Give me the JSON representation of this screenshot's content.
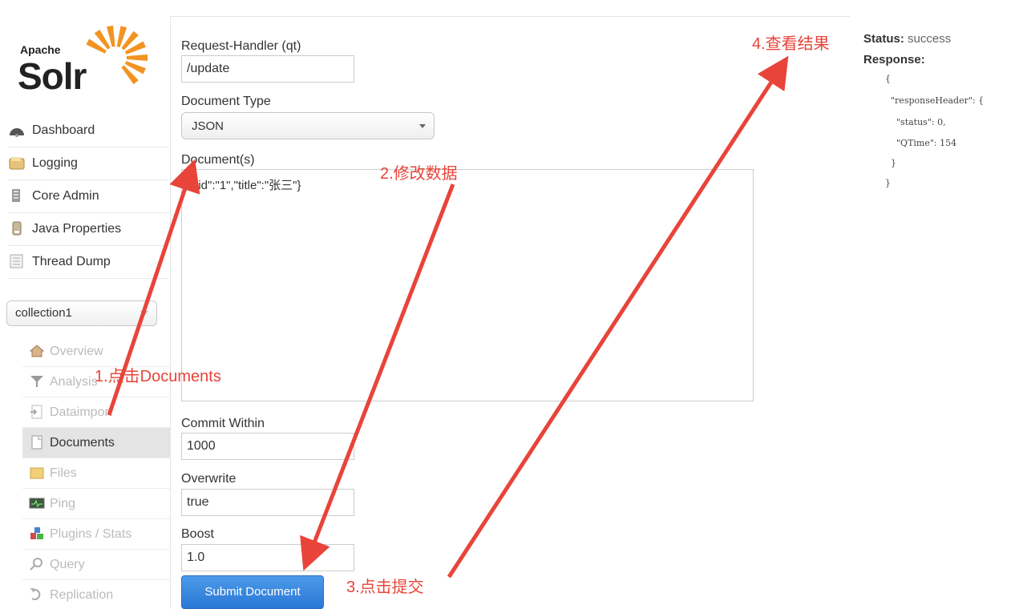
{
  "logo": {
    "apache": "Apache",
    "solr": "Solr"
  },
  "sidebar": {
    "main_items": [
      {
        "label": "Dashboard",
        "icon": "dashboard-icon"
      },
      {
        "label": "Logging",
        "icon": "logging-icon"
      },
      {
        "label": "Core Admin",
        "icon": "core-admin-icon"
      },
      {
        "label": "Java Properties",
        "icon": "java-properties-icon"
      },
      {
        "label": "Thread Dump",
        "icon": "thread-dump-icon"
      }
    ],
    "core_selector": "collection1",
    "core_items": [
      {
        "label": "Overview",
        "icon": "overview-icon"
      },
      {
        "label": "Analysis",
        "icon": "analysis-icon"
      },
      {
        "label": "Dataimport",
        "icon": "dataimport-icon"
      },
      {
        "label": "Documents",
        "icon": "documents-icon",
        "active": true
      },
      {
        "label": "Files",
        "icon": "files-icon"
      },
      {
        "label": "Ping",
        "icon": "ping-icon"
      },
      {
        "label": "Plugins / Stats",
        "icon": "plugins-icon"
      },
      {
        "label": "Query",
        "icon": "query-icon"
      },
      {
        "label": "Replication",
        "icon": "replication-icon"
      }
    ]
  },
  "form": {
    "request_handler_label": "Request-Handler (qt)",
    "request_handler_value": "/update",
    "document_type_label": "Document Type",
    "document_type_value": "JSON",
    "documents_label": "Document(s)",
    "documents_value": "{\"id\":\"1\",\"title\":\"张三\"}",
    "commit_within_label": "Commit Within",
    "commit_within_value": "1000",
    "overwrite_label": "Overwrite",
    "overwrite_value": "true",
    "boost_label": "Boost",
    "boost_value": "1.0",
    "submit_label": "Submit Document"
  },
  "response": {
    "status_label": "Status:",
    "status_value": "success",
    "response_label": "Response:",
    "json_lines": [
      "{",
      "  \"responseHeader\": {",
      "    \"status\": 0,",
      "    \"QTime\": 154",
      "  }",
      "}"
    ]
  },
  "annotations": {
    "step1": "1.点击Documents",
    "step2": "2.修改数据",
    "step3": "3.点击提交",
    "step4": "4.查看结果"
  },
  "colors": {
    "annotation": "#e8443a",
    "submit_button": "#2a78d6",
    "active_nav": "#e4e4e4"
  }
}
